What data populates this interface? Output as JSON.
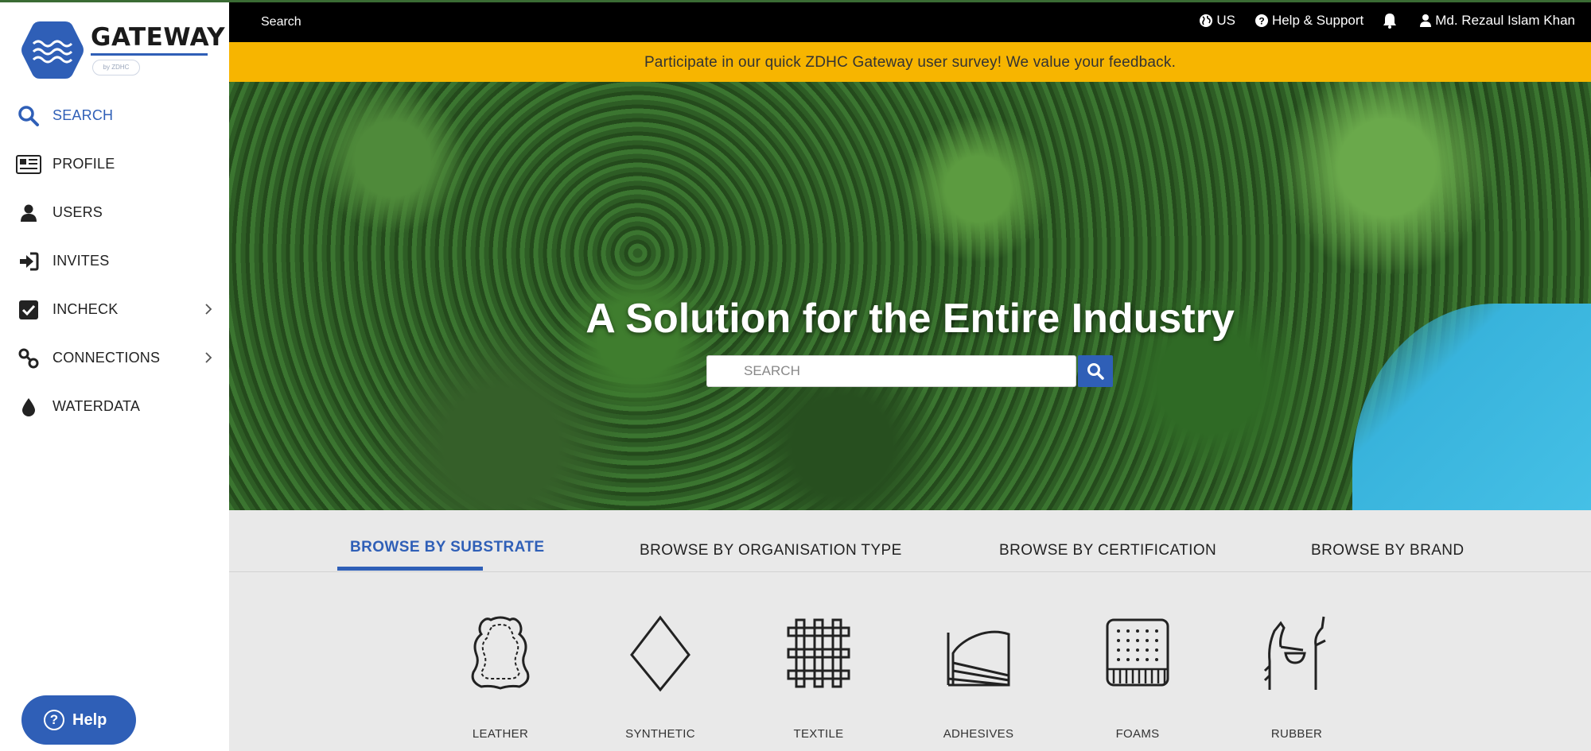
{
  "app": {
    "logo_text": "GATEWAY",
    "logo_sub": "by ZDHC"
  },
  "sidebar": {
    "items": [
      {
        "label": "SEARCH"
      },
      {
        "label": "PROFILE"
      },
      {
        "label": "USERS"
      },
      {
        "label": "INVITES"
      },
      {
        "label": "INCHECK"
      },
      {
        "label": "CONNECTIONS"
      },
      {
        "label": "WATERDATA"
      }
    ],
    "help_label": "Help"
  },
  "topbar": {
    "search_label": "Search",
    "region_label": "US",
    "help_support_label": "Help & Support",
    "user_name": "Md. Rezaul Islam Khan"
  },
  "banner": {
    "text": "Participate in our quick ZDHC Gateway user survey! We value your feedback."
  },
  "hero": {
    "title": "A Solution for the Entire Industry",
    "search_placeholder": "SEARCH"
  },
  "browse": {
    "tabs": [
      {
        "label": "BROWSE BY SUBSTRATE"
      },
      {
        "label": "BROWSE BY ORGANISATION TYPE"
      },
      {
        "label": "BROWSE BY CERTIFICATION"
      },
      {
        "label": "BROWSE BY BRAND"
      }
    ],
    "substrates": [
      {
        "label": "LEATHER",
        "icon": "leather-icon"
      },
      {
        "label": "SYNTHETIC",
        "icon": "synthetic-icon"
      },
      {
        "label": "TEXTILE",
        "icon": "textile-icon"
      },
      {
        "label": "ADHESIVES",
        "icon": "adhesives-icon"
      },
      {
        "label": "FOAMS",
        "icon": "foams-icon"
      },
      {
        "label": "RUBBER",
        "icon": "rubber-icon"
      }
    ]
  },
  "colors": {
    "accent": "#2f5fb7",
    "banner": "#f7b500",
    "topbar": "#000000",
    "browse_bg": "#e9e9e9"
  }
}
